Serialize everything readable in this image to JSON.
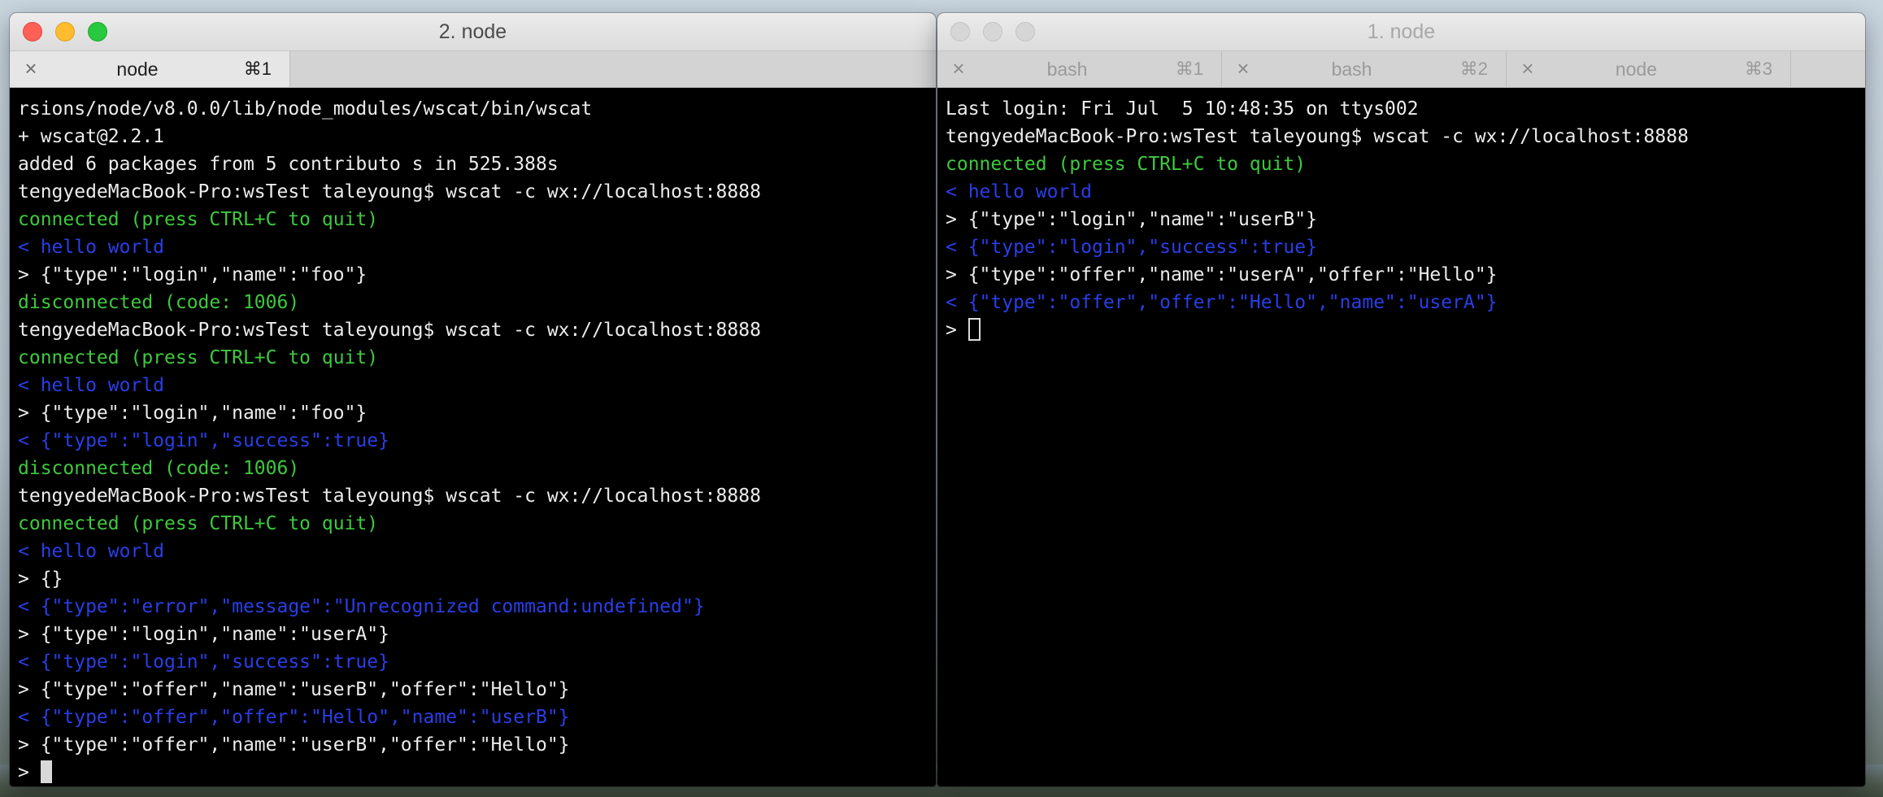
{
  "left_window": {
    "title": "2. node",
    "tabs": [
      {
        "label": "node",
        "shortcut": "⌘1",
        "active": true
      }
    ],
    "lines": [
      {
        "text": "rsions/node/v8.0.0/lib/node_modules/wscat/bin/wscat",
        "color": "white"
      },
      {
        "text": "+ wscat@2.2.1",
        "color": "white"
      },
      {
        "text": "added 6 packages from 5 contributo s in 525.388s",
        "color": "white"
      },
      {
        "text": "tengyedeMacBook-Pro:wsTest taleyoung$ wscat -c wx://localhost:8888",
        "color": "white"
      },
      {
        "text": "connected (press CTRL+C to quit)",
        "color": "green"
      },
      {
        "text": "< hello world",
        "color": "blue"
      },
      {
        "text": "> {\"type\":\"login\",\"name\":\"foo\"}",
        "color": "white"
      },
      {
        "text": "disconnected (code: 1006)",
        "color": "green"
      },
      {
        "text": "tengyedeMacBook-Pro:wsTest taleyoung$ wscat -c wx://localhost:8888",
        "color": "white"
      },
      {
        "text": "connected (press CTRL+C to quit)",
        "color": "green"
      },
      {
        "text": "< hello world",
        "color": "blue"
      },
      {
        "text": "> {\"type\":\"login\",\"name\":\"foo\"}",
        "color": "white"
      },
      {
        "text": "< {\"type\":\"login\",\"success\":true}",
        "color": "blue"
      },
      {
        "text": "disconnected (code: 1006)",
        "color": "green"
      },
      {
        "text": "tengyedeMacBook-Pro:wsTest taleyoung$ wscat -c wx://localhost:8888",
        "color": "white"
      },
      {
        "text": "connected (press CTRL+C to quit)",
        "color": "green"
      },
      {
        "text": "< hello world",
        "color": "blue"
      },
      {
        "text": "> {}",
        "color": "white"
      },
      {
        "text": "< {\"type\":\"error\",\"message\":\"Unrecognized command:undefined\"}",
        "color": "blue"
      },
      {
        "text": "> {\"type\":\"login\",\"name\":\"userA\"}",
        "color": "white"
      },
      {
        "text": "< {\"type\":\"login\",\"success\":true}",
        "color": "blue"
      },
      {
        "text": "> {\"type\":\"offer\",\"name\":\"userB\",\"offer\":\"Hello\"}",
        "color": "white"
      },
      {
        "text": "< {\"type\":\"offer\",\"offer\":\"Hello\",\"name\":\"userB\"}",
        "color": "blue"
      },
      {
        "text": "> {\"type\":\"offer\",\"name\":\"userB\",\"offer\":\"Hello\"}",
        "color": "white"
      }
    ],
    "prompt": ">"
  },
  "right_window": {
    "title": "1. node",
    "tabs": [
      {
        "label": "bash",
        "shortcut": "⌘1",
        "active": false
      },
      {
        "label": "bash",
        "shortcut": "⌘2",
        "active": false
      },
      {
        "label": "node",
        "shortcut": "⌘3",
        "active": false
      }
    ],
    "lines": [
      {
        "text": "Last login: Fri Jul  5 10:48:35 on ttys002",
        "color": "white"
      },
      {
        "text": "tengyedeMacBook-Pro:wsTest taleyoung$ wscat -c wx://localhost:8888",
        "color": "white"
      },
      {
        "text": "connected (press CTRL+C to quit)",
        "color": "green"
      },
      {
        "text": "< hello world",
        "color": "blue"
      },
      {
        "text": "> {\"type\":\"login\",\"name\":\"userB\"}",
        "color": "white"
      },
      {
        "text": "< {\"type\":\"login\",\"success\":true}",
        "color": "blue"
      },
      {
        "text": "> {\"type\":\"offer\",\"name\":\"userA\",\"offer\":\"Hello\"}",
        "color": "white"
      },
      {
        "text": "< {\"type\":\"offer\",\"offer\":\"Hello\",\"name\":\"userA\"}",
        "color": "blue"
      }
    ],
    "prompt": ">"
  },
  "icons": {
    "tab_close": "close-icon",
    "window_buttons": [
      "close-window-icon",
      "minimize-window-icon",
      "zoom-window-icon"
    ]
  },
  "colors": {
    "terminal_bg": "#000000",
    "text_white": "#ececec",
    "text_green": "#3dc93d",
    "text_blue": "#2a3ee8",
    "traffic_red": "#fe5f57",
    "traffic_yellow": "#febc2e",
    "traffic_green": "#28c840"
  }
}
